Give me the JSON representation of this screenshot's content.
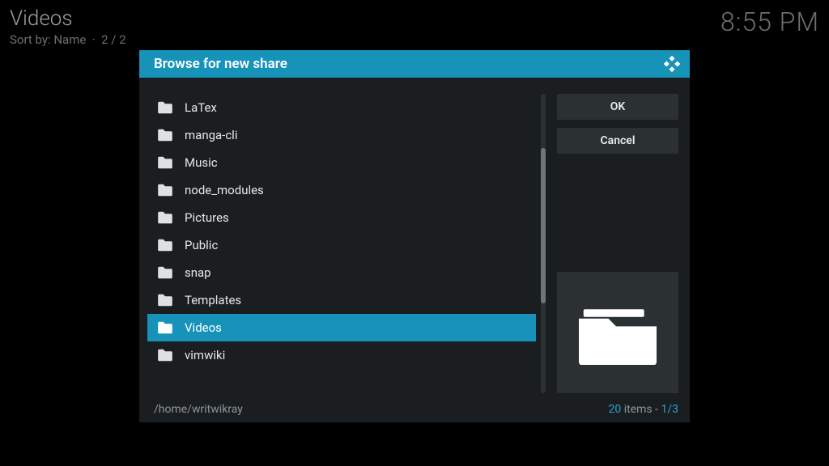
{
  "background": {
    "title": "Videos",
    "sort_label": "Sort by: Name",
    "page_label": "2 / 2",
    "clock": "8:55 PM"
  },
  "dialog": {
    "title": "Browse for new share",
    "ok_label": "OK",
    "cancel_label": "Cancel",
    "path": "/home/writwikray",
    "item_count": "20",
    "items_word": "items",
    "page": "1/3",
    "selected_index": 8,
    "folders": [
      "LaTex",
      "manga-cli",
      "Music",
      "node_modules",
      "Pictures",
      "Public",
      "snap",
      "Templates",
      "Videos",
      "vimwiki"
    ],
    "scroll": {
      "thumb_top_pct": 18,
      "thumb_height_pct": 52
    }
  }
}
